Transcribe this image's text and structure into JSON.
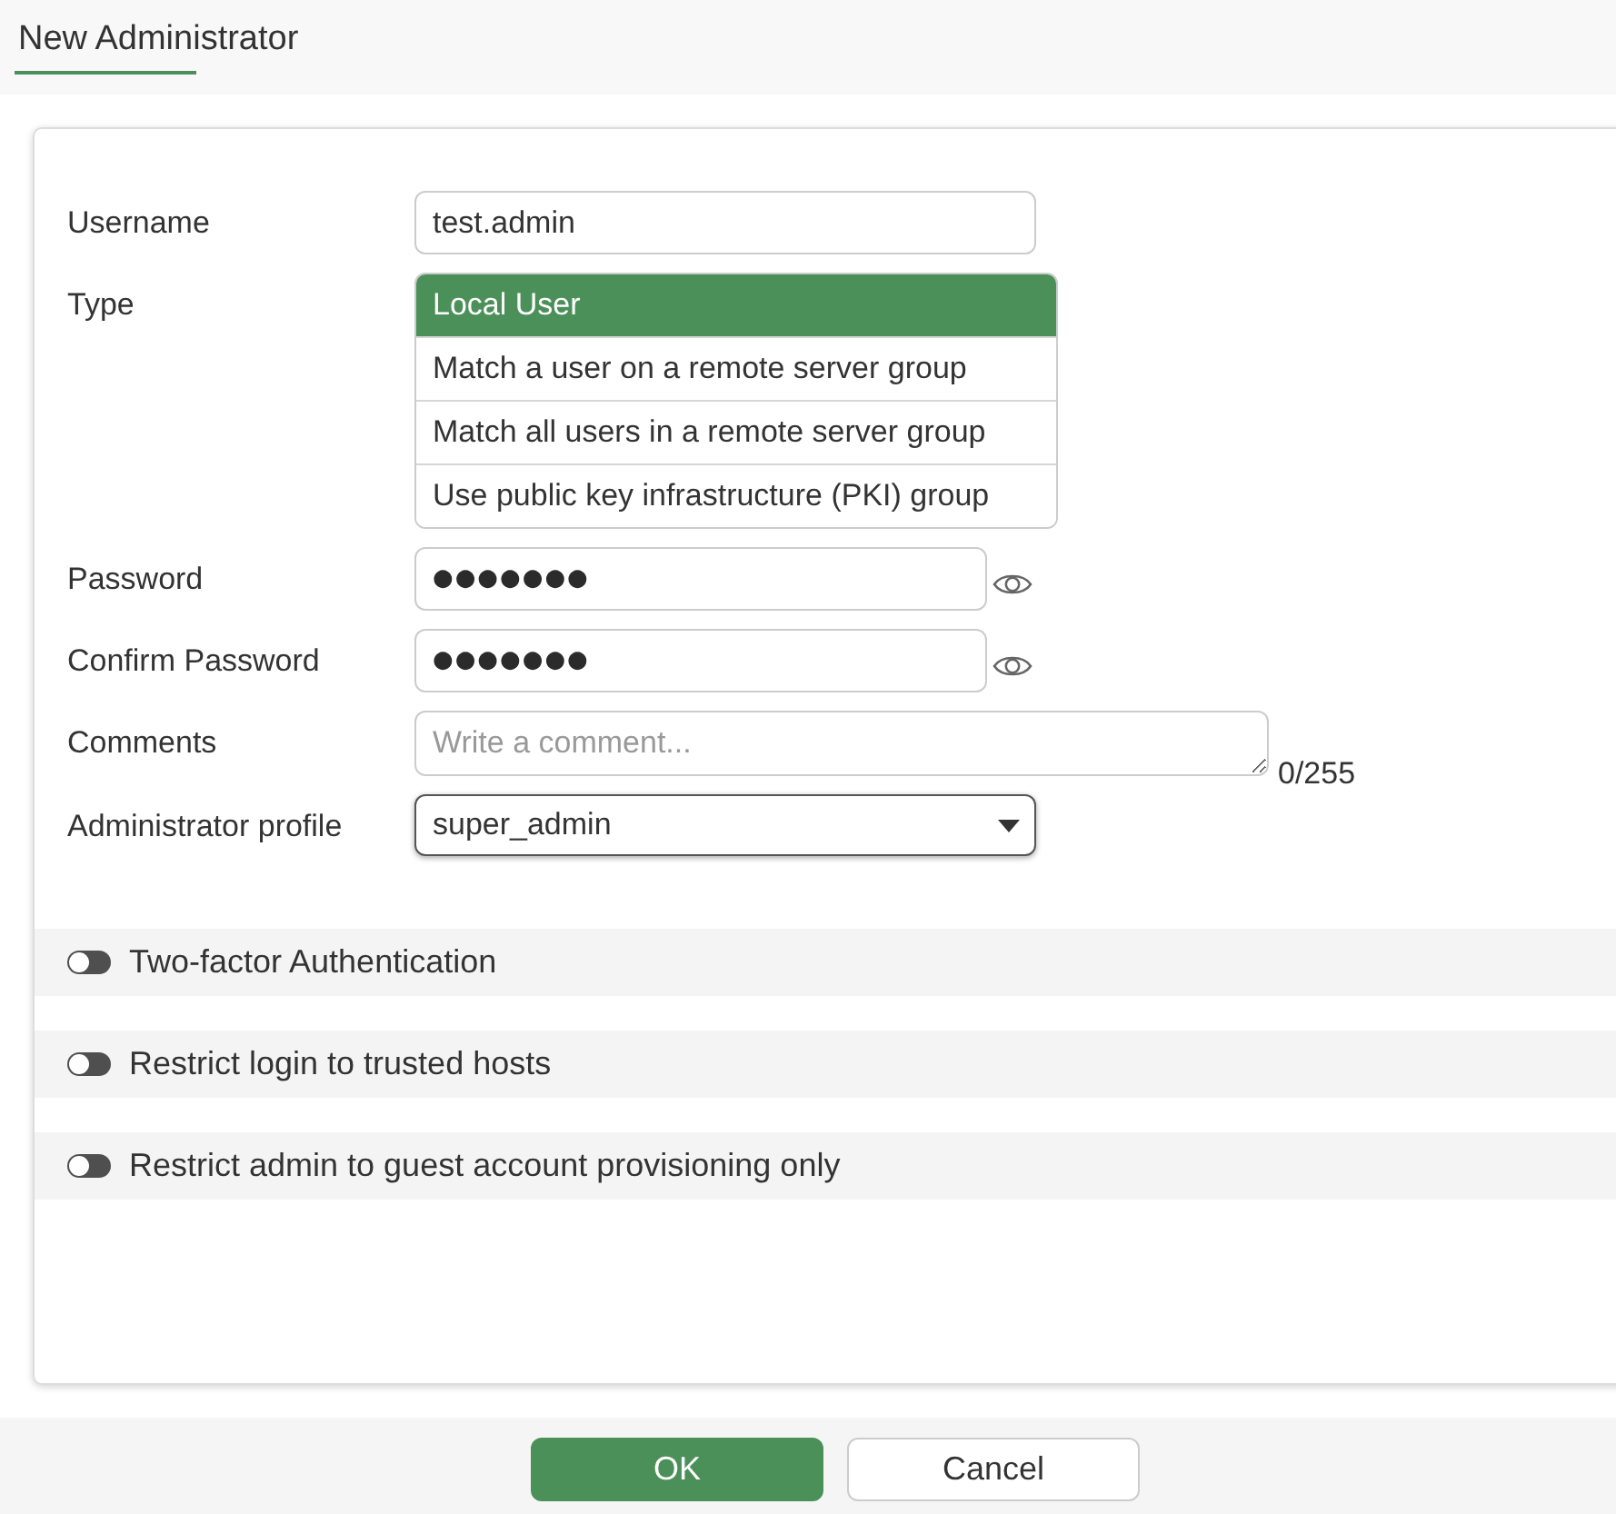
{
  "header": {
    "title": "New Administrator"
  },
  "form": {
    "fields": [
      {
        "kind": "text",
        "label": "Username",
        "value": "test.admin"
      },
      {
        "kind": "choice",
        "label": "Type",
        "options": [
          {
            "label": "Local User",
            "selected": true
          },
          {
            "label": "Match a user on a remote server group",
            "selected": false
          },
          {
            "label": "Match all users in a remote server group",
            "selected": false
          },
          {
            "label": "Use public key infrastructure (PKI) group",
            "selected": false
          }
        ]
      },
      {
        "kind": "password",
        "label": "Password",
        "value": "●●●●●●●"
      },
      {
        "kind": "password",
        "label": "Confirm Password",
        "value": "●●●●●●●"
      },
      {
        "kind": "textarea",
        "label": "Comments",
        "placeholder": "Write a comment...",
        "counter": "0/255"
      },
      {
        "kind": "dropdown",
        "label": "Administrator profile",
        "value": "super_admin"
      }
    ]
  },
  "sections": [
    {
      "label": "Two-factor Authentication",
      "on": false
    },
    {
      "label": "Restrict login to trusted hosts",
      "on": false
    },
    {
      "label": "Restrict admin to guest account provisioning only",
      "on": false
    }
  ],
  "footer": {
    "buttons": [
      {
        "label": "OK",
        "kind": "primary"
      },
      {
        "label": "Cancel",
        "kind": "secondary"
      }
    ]
  }
}
